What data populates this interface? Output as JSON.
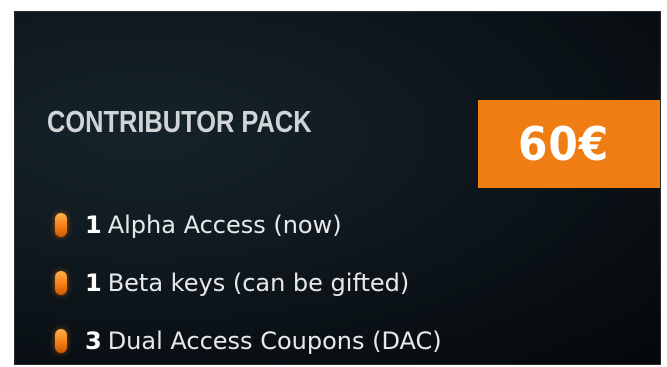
{
  "pack": {
    "title": "CONTRIBUTOR PACK",
    "price": "60€",
    "accent_color": "#f07d14",
    "features": [
      {
        "qty": "1",
        "text": "Alpha Access (now)"
      },
      {
        "qty": "1",
        "text": "Beta keys (can be gifted)"
      },
      {
        "qty": "3",
        "text": "Dual Access Coupons (DAC)"
      }
    ]
  }
}
